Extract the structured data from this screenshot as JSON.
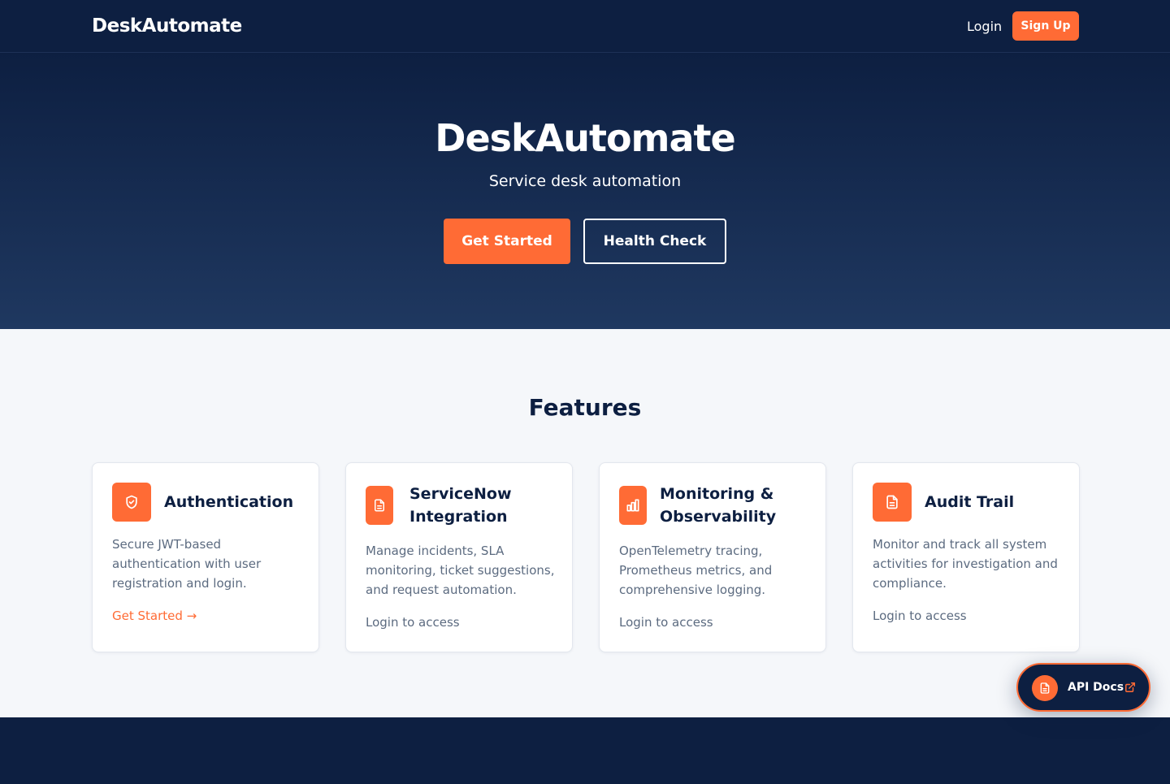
{
  "nav": {
    "brand": "DeskAutomate",
    "login_label": "Login",
    "signup_label": "Sign Up"
  },
  "hero": {
    "title": "DeskAutomate",
    "subtitle": "Service desk automation",
    "primary_cta": "Get Started",
    "secondary_cta": "Health Check"
  },
  "features": {
    "heading": "Features",
    "cards": [
      {
        "icon": "shield-check-icon",
        "title_lines": [
          "Authentication"
        ],
        "description_lines": [
          "Secure JWT-based",
          "authentication with user",
          "registration and login."
        ],
        "link": "Get Started →",
        "link_style": "accent"
      },
      {
        "icon": "document-icon",
        "title_lines": [
          "ServiceNow",
          "Integration"
        ],
        "description_lines": [
          "Manage incidents, SLA",
          "monitoring, ticket suggestions,",
          "and request automation."
        ],
        "link": "Login to access",
        "link_style": "muted"
      },
      {
        "icon": "bar-chart-icon",
        "title_lines": [
          "Monitoring &",
          "Observability"
        ],
        "description_lines": [
          "OpenTelemetry tracing,",
          "Prometheus metrics, and",
          "comprehensive logging."
        ],
        "link": "Login to access",
        "link_style": "muted"
      },
      {
        "icon": "document-icon",
        "title_lines": [
          "Audit Trail"
        ],
        "description_lines": [
          "Monitor and track all system",
          "activities for investigation and",
          "compliance."
        ],
        "link": "Login to access",
        "link_style": "muted"
      }
    ]
  },
  "api_docs": {
    "label": "API Docs",
    "icon": "document-icon",
    "trailing_icon": "external-link-icon"
  },
  "colors": {
    "navy": "#0d1f41",
    "accent": "#ff6b35",
    "muted_text": "#5c6b80",
    "page_bg": "#f5f7fa"
  }
}
